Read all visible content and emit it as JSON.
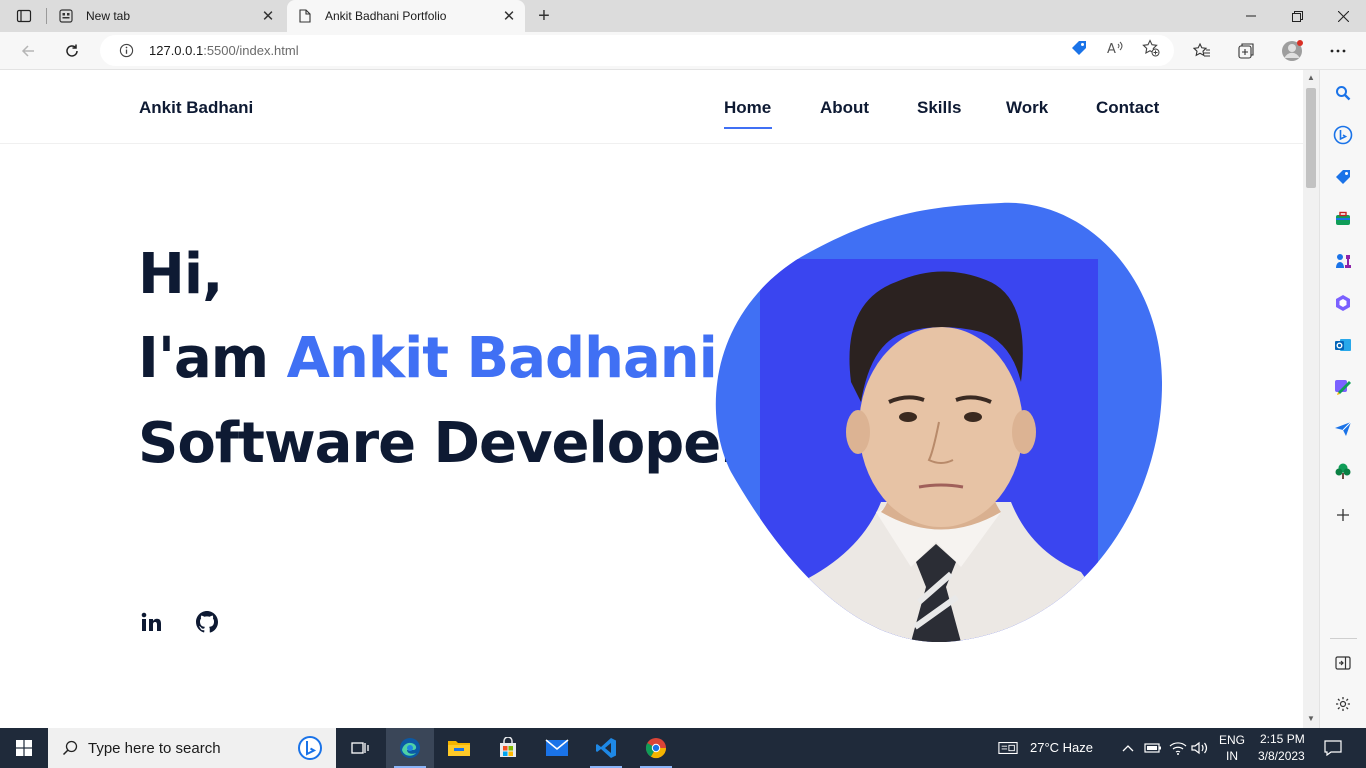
{
  "browser": {
    "tabs": [
      {
        "title": "New tab",
        "active": false
      },
      {
        "title": "Ankit Badhani Portfolio",
        "active": true
      }
    ],
    "url_host": "127.0.0.1",
    "url_rest": ":5500/index.html"
  },
  "site": {
    "logo": "Ankit Badhani",
    "nav": [
      "Home",
      "About",
      "Skills",
      "Work",
      "Contact"
    ],
    "active_nav": "Home",
    "hero": {
      "greeting": "Hi,",
      "intro_prefix": "I'am ",
      "name": "Ankit Badhani",
      "role": "Software Developer"
    },
    "social": [
      "linkedin-icon",
      "github-icon"
    ],
    "accent_color": "#4070f4",
    "text_color": "#0e1a33"
  },
  "taskbar": {
    "search_placeholder": "Type here to search",
    "weather": "27°C  Haze",
    "lang_line1": "ENG",
    "lang_line2": "IN",
    "time": "2:15 PM",
    "date": "3/8/2023"
  }
}
